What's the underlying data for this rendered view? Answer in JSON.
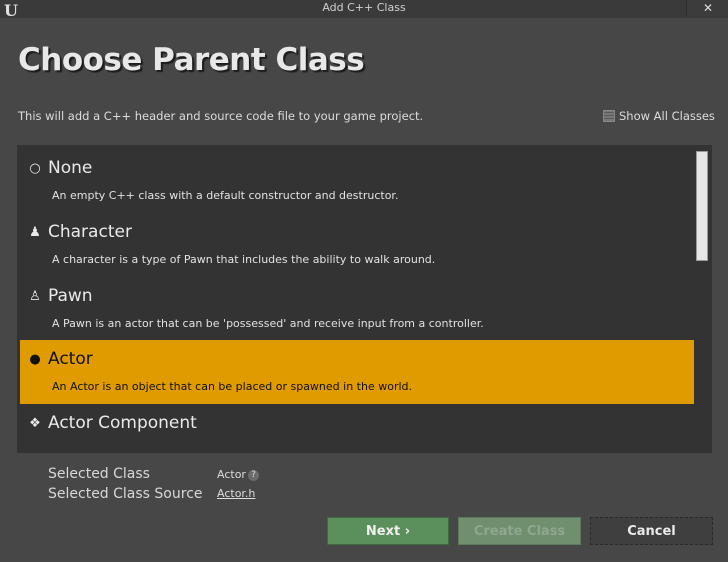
{
  "window": {
    "title": "Add C++ Class",
    "logo": "U",
    "close_symbol": "✕"
  },
  "heading": "Choose Parent Class",
  "description": "This will add a C++ header and source code file to your game project.",
  "show_all_label": "Show All Classes",
  "classes": [
    {
      "name": "None",
      "desc": "An empty C++ class with a default constructor and destructor.",
      "icon": "circle-outline-icon",
      "glyph": "○"
    },
    {
      "name": "Character",
      "desc": "A character is a type of Pawn that includes the ability to walk around.",
      "icon": "character-icon",
      "glyph": "♟"
    },
    {
      "name": "Pawn",
      "desc": "A Pawn is an actor that can be 'possessed' and receive input from a controller.",
      "icon": "pawn-icon",
      "glyph": "♙"
    },
    {
      "name": "Actor",
      "desc": "An Actor is an object that can be placed or spawned in the world.",
      "icon": "actor-icon",
      "glyph": "●"
    },
    {
      "name": "Actor Component",
      "desc": "",
      "icon": "actor-component-icon",
      "glyph": "❖"
    }
  ],
  "selected_index": 3,
  "selected_class_label": "Selected Class",
  "selected_class_value": "Actor",
  "selected_source_label": "Selected Class Source",
  "selected_source_value": "Actor.h",
  "help_symbol": "?",
  "buttons": {
    "next": "Next ›",
    "create": "Create Class",
    "cancel": "Cancel"
  },
  "colors": {
    "selection": "#e09b00",
    "next_button": "#5b8f5b",
    "create_button": "#6f8f6f"
  }
}
